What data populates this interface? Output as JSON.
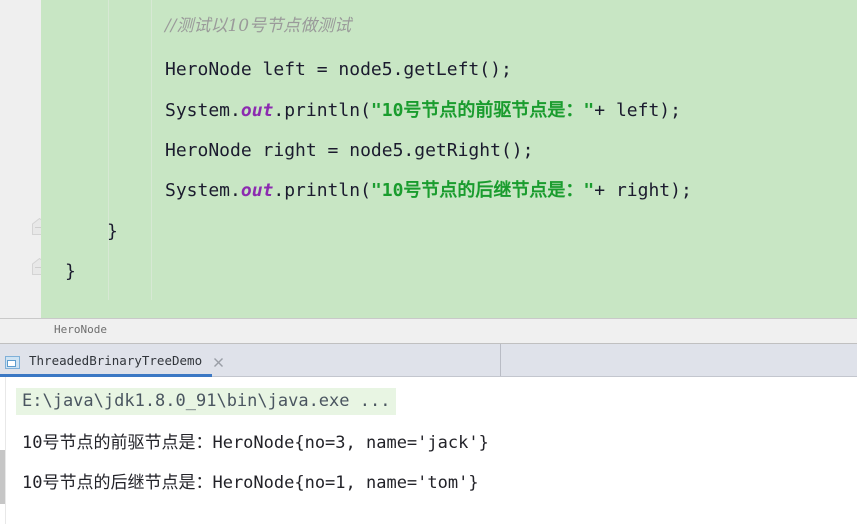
{
  "editor": {
    "background_color": "#c8e6c4",
    "gutter_color": "#efefef",
    "lines": [
      {
        "id": "comment",
        "kind": "comment",
        "text": "//测试以10号节点做测试"
      },
      {
        "id": "decl-left",
        "kind": "code",
        "text": "HeroNode left = node5.getLeft();"
      },
      {
        "id": "print-left",
        "kind": "code",
        "prefix": "System.",
        "field": "out",
        "mid": ".println(",
        "string": "\"10号节点的前驱节点是：\"",
        "suffix": "+ left);"
      },
      {
        "id": "decl-right",
        "kind": "code",
        "text": "HeroNode right = node5.getRight();"
      },
      {
        "id": "print-right",
        "kind": "code",
        "prefix": "System.",
        "field": "out",
        "mid": ".println(",
        "string": "\"10号节点的后继节点是：\"",
        "suffix": "+ right);"
      },
      {
        "id": "close-method",
        "kind": "code",
        "text": "}"
      },
      {
        "id": "close-class",
        "kind": "code",
        "text": "}"
      }
    ],
    "fold_markers": [
      {
        "id": "fold-method",
        "state": "expanded",
        "glyph": "-"
      },
      {
        "id": "fold-class",
        "state": "expanded",
        "glyph": "-"
      }
    ]
  },
  "breadcrumb": {
    "text": "HeroNode"
  },
  "run_panel": {
    "tab": {
      "label": "ThreadedBrinaryTreeDemo",
      "icon": "run-configuration-icon",
      "close_icon": "close-icon",
      "active": true,
      "accent_color": "#3b78c4"
    },
    "console": {
      "command_line": "E:\\java\\jdk1.8.0_91\\bin\\java.exe ...",
      "command_highlight_color": "#e8f5e3",
      "output_lines": [
        "10号节点的前驱节点是：HeroNode{no=3, name='jack'}",
        "10号节点的后继节点是：HeroNode{no=1, name='tom'}"
      ]
    }
  },
  "colors": {
    "editor_bg": "#c8e6c4",
    "string_token": "#1a9c2e",
    "field_token": "#8c2bb0",
    "comment_token": "#9a9a9a",
    "code_text": "#1b1b2e",
    "tabstrip_bg": "#dfe2ea",
    "tab_accent": "#3b78c4"
  }
}
